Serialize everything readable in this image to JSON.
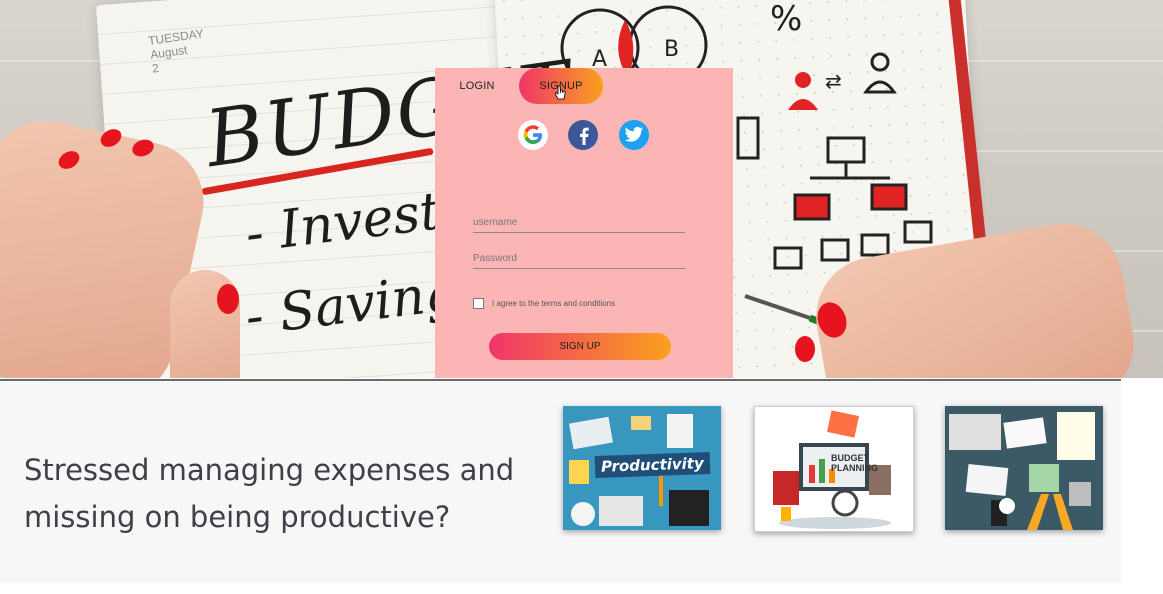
{
  "hero": {
    "handwriting": {
      "date_label": "TUESDAY\nAugust\n2",
      "title": "BUDGET",
      "line1": "- Investm",
      "line2": "- Saving"
    }
  },
  "auth": {
    "tabs": [
      {
        "label": "LOGIN",
        "active": false
      },
      {
        "label": "SIGNUP",
        "active": true
      }
    ],
    "social": [
      "google-icon",
      "facebook-icon",
      "twitter-icon"
    ],
    "username_placeholder": "username",
    "password_placeholder": "Password",
    "terms_label": "I agree to the terms and conditions",
    "submit_label": "SIGN UP",
    "colors": {
      "card_bg": "#fbb5b5",
      "gradient_start": "#f0356a",
      "gradient_end": "#f9a11d"
    }
  },
  "promo": {
    "tagline": "Stressed managing expenses and missing on being productive?",
    "thumbnails": [
      {
        "caption": "Productivity"
      },
      {
        "caption": "BUDGET PLANNING"
      },
      {
        "caption": ""
      }
    ]
  }
}
